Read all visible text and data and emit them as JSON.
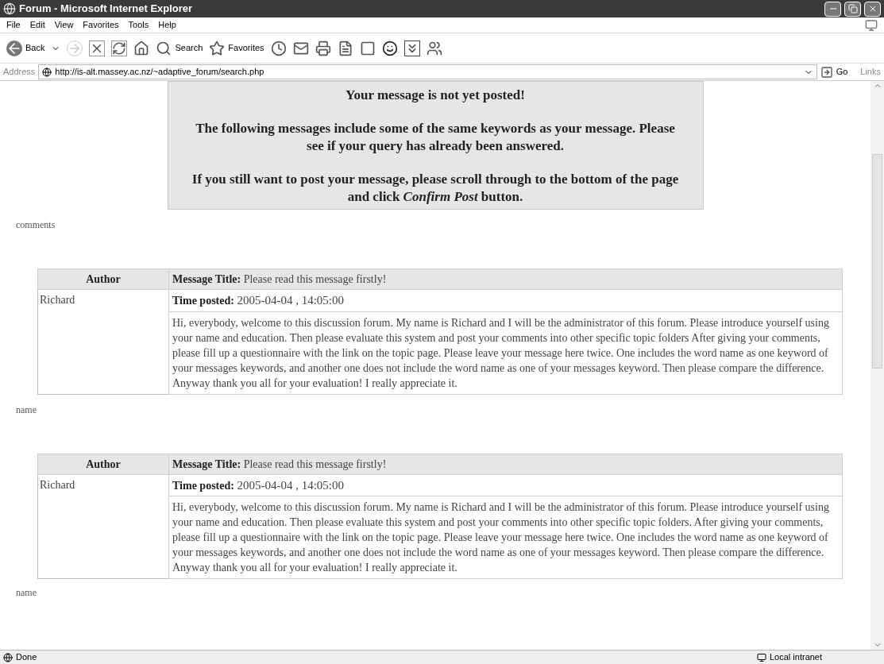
{
  "window": {
    "title": "Forum - Microsoft Internet Explorer"
  },
  "menu": [
    "File",
    "Edit",
    "View",
    "Favorites",
    "Tools",
    "Help"
  ],
  "toolbar": {
    "back": "Back",
    "search": "Search",
    "favorites": "Favorites"
  },
  "address": {
    "label": "Address",
    "url": "http://is-alt.massey.ac.nz/~adaptive_forum/search.php",
    "go": "Go",
    "links": "Links"
  },
  "notice": {
    "heading": "Your message is not yet posted!",
    "paragraphs": [
      "The following messages include some of the same keywords as your message. Please see if your query has already been answered.",
      "If you still want to post your message, please scroll through to the bottom of the page and click *Confirm Post* button."
    ]
  },
  "sections": [
    {
      "keyword": "comments",
      "post": {
        "author_header": "Author",
        "title_label": "Message Title:",
        "title": "Please read this message firstly!",
        "author": "Richard",
        "time_label": "Time posted:",
        "time": "2005-04-04 , 14:05:00",
        "body": "Hi, everybody, welcome to this discussion forum. My name is Richard and I will be the administrator of this forum. Please introduce yourself using your name and education. Then please evaluate this system and post your comments into other specific topic folders  After giving your comments, please fill up a questionnaire with the link on the topic page. Please leave your message here twice. One includes the word name as one keyword of your messages keywords, and another one does not include the word name as one of your messages keyword. Then please compare the difference. Anyway thank you all for your evaluation! I really appreciate it."
      }
    },
    {
      "keyword": "name",
      "post": {
        "author_header": "Author",
        "title_label": "Message Title:",
        "title": "Please read this message firstly!",
        "author": "Richard",
        "time_label": "Time posted:",
        "time": "2005-04-04 , 14:05:00",
        "body": "Hi, everybody, welcome to this discussion forum. My name is Richard and I will be the administrator of this forum. Please introduce yourself using your name and education. Then please evaluate this system and post your comments into other specific topic folders. After giving your comments, please fill up a questionnaire with the link on the topic page. Please leave your message here twice. One includes the word name as one keyword of your messages keywords, and another one does not include the word name as one of your messages keyword. Then please compare the difference. Anyway thank you all for your evaluation! I really appreciate it."
      }
    }
  ],
  "trailing_keyword": "name",
  "status_bar": {
    "left": "Done",
    "right": "Local intranet"
  }
}
